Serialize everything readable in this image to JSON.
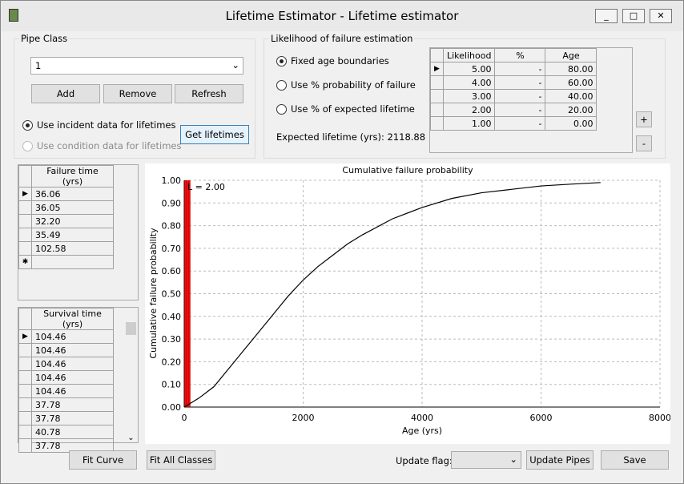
{
  "window": {
    "title": "Lifetime Estimator - Lifetime estimator",
    "minimize": "_",
    "restore": "□",
    "close": "✕"
  },
  "pipe_class": {
    "label": "Pipe Class",
    "selected": "1",
    "add": "Add",
    "remove": "Remove",
    "refresh": "Refresh",
    "use_incident": "Use incident data for lifetimes",
    "use_condition": "Use condition data for lifetimes",
    "get_lifetimes": "Get lifetimes"
  },
  "likelihood": {
    "label": "Likelihood of failure estimation",
    "options": [
      "Fixed age boundaries",
      "Use % probability of failure",
      "Use % of expected lifetime"
    ],
    "selected": 0,
    "expected_lifetime": "Expected lifetime (yrs): 2118.88",
    "columns": [
      "Likelihood",
      "%",
      "Age"
    ],
    "rows": [
      [
        "5.00",
        "-",
        "80.00"
      ],
      [
        "4.00",
        "-",
        "60.00"
      ],
      [
        "3.00",
        "-",
        "40.00"
      ],
      [
        "2.00",
        "-",
        "20.00"
      ],
      [
        "1.00",
        "-",
        "0.00"
      ]
    ],
    "plus": "+",
    "minus": "-"
  },
  "failure": {
    "header": "Failure time (yrs)",
    "rows": [
      "36.06",
      "36.05",
      "32.20",
      "35.49",
      "102.58"
    ],
    "new_row": "✱"
  },
  "survival": {
    "header": "Survival time (yrs)",
    "rows": [
      "104.46",
      "104.46",
      "104.46",
      "104.46",
      "104.46",
      "37.78",
      "37.78",
      "40.78",
      "37.78"
    ]
  },
  "footer": {
    "fit_curve": "Fit Curve",
    "fit_all": "Fit All Classes",
    "update_flag_label": "Update flag:",
    "update_flag_value": "",
    "update_pipes": "Update Pipes",
    "save": "Save"
  },
  "chart_data": {
    "type": "line",
    "title": "Cumulative failure probability",
    "xlabel": "Age (yrs)",
    "ylabel": "Cumulative failure probability",
    "xlim": [
      0,
      8000
    ],
    "ylim": [
      0,
      1
    ],
    "grid": true,
    "xticks": [
      "0",
      "2000",
      "4000",
      "6000",
      "8000"
    ],
    "yticks": [
      "0.00",
      "0.10",
      "0.20",
      "0.30",
      "0.40",
      "0.50",
      "0.60",
      "0.70",
      "0.80",
      "0.90",
      "1.00"
    ],
    "series": [
      {
        "x": [
          0,
          250,
          500,
          750,
          1000,
          1250,
          1500,
          1750,
          2000,
          2250,
          2500,
          2750,
          3000,
          3500,
          4000,
          4500,
          5000,
          5500,
          6000,
          6500,
          7000
        ],
        "y": [
          0,
          0.04,
          0.09,
          0.17,
          0.25,
          0.33,
          0.41,
          0.49,
          0.56,
          0.62,
          0.67,
          0.72,
          0.76,
          0.83,
          0.88,
          0.92,
          0.945,
          0.96,
          0.975,
          0.983,
          0.99
        ],
        "color": "#000000"
      }
    ],
    "boundaries": {
      "ages": [
        0,
        20,
        40,
        60,
        80
      ],
      "color": "#e00000"
    },
    "annotation": "L = 2.00"
  }
}
